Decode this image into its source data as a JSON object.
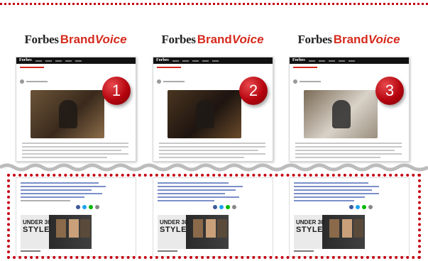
{
  "brand": {
    "forbes": "Forbes",
    "brand": "Brand",
    "voice": "Voice"
  },
  "panels": [
    {
      "number": "1",
      "logo": "Forbes",
      "banner_small": "UNDER 30",
      "banner_big": "STYLE"
    },
    {
      "number": "2",
      "logo": "Forbes",
      "banner_small": "UNDER 30",
      "banner_big": "STYLE"
    },
    {
      "number": "3",
      "logo": "Forbes",
      "banner_small": "UNDER 30",
      "banner_big": "STYLE"
    }
  ],
  "colors": {
    "accent": "#c40012",
    "brand_red": "#d52b1e"
  }
}
